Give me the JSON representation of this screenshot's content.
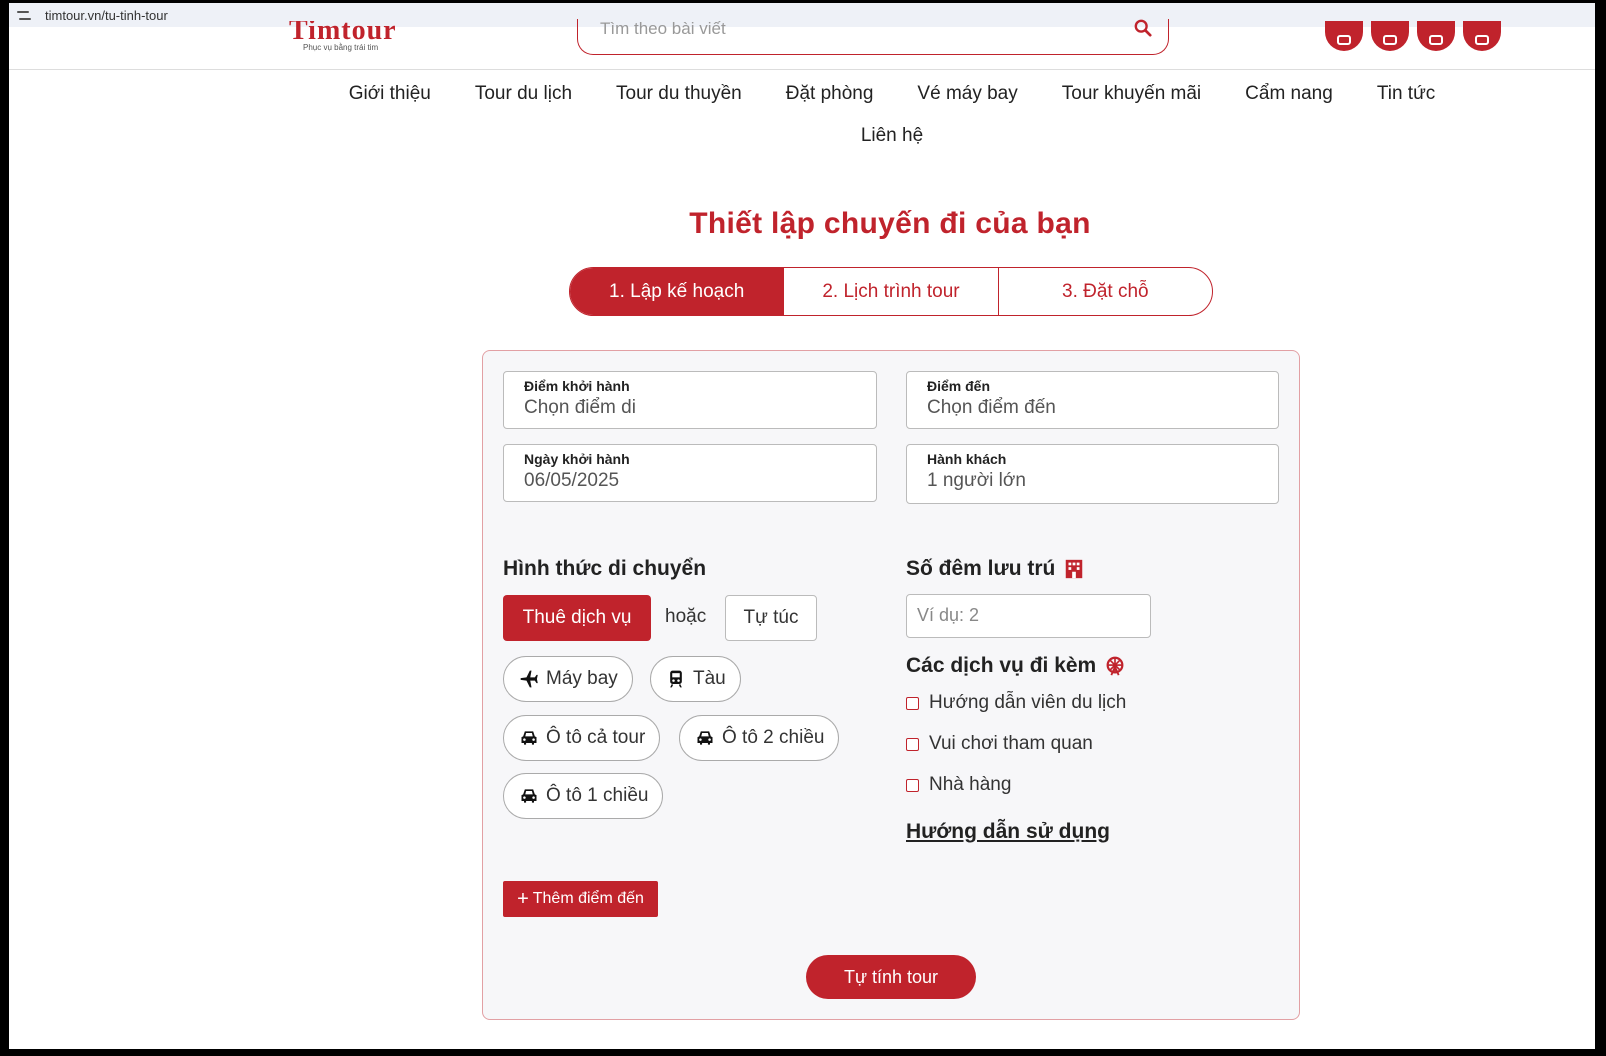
{
  "browser": {
    "url": "timtour.vn/tu-tinh-tour"
  },
  "header": {
    "logo_text": "Timtour",
    "logo_tagline": "Phục vụ bằng trái tim",
    "search_placeholder": "Tìm theo bài viết",
    "socials": [
      "facebook-icon",
      "youtube-icon",
      "instagram-icon",
      "tiktok-icon"
    ]
  },
  "nav": {
    "items": [
      "Giới thiệu",
      "Tour du lịch",
      "Tour du thuyền",
      "Đặt phòng",
      "Vé máy bay",
      "Tour khuyến mãi",
      "Cẩm nang",
      "Tin tức"
    ],
    "contact": "Liên hệ"
  },
  "page_title": "Thiết lập chuyến đi của bạn",
  "steps": [
    "1. Lập kế hoạch",
    "2. Lịch trình tour",
    "3. Đặt chỗ"
  ],
  "form": {
    "departure": {
      "label": "Điểm khởi hành",
      "value": "Chọn điểm di"
    },
    "destination": {
      "label": "Điểm đến",
      "value": "Chọn điểm đến"
    },
    "date": {
      "label": "Ngày khởi hành",
      "value": "06/05/2025"
    },
    "guests": {
      "label": "Hành khách",
      "value": "1 người lớn"
    }
  },
  "transport": {
    "title": "Hình thức di chuyển",
    "hire": "Thuê dịch vụ",
    "or": "hoặc",
    "self": "Tự túc",
    "options": [
      "Máy bay",
      "Tàu",
      "Ô tô cả tour",
      "Ô tô 2 chiều",
      "Ô tô 1 chiều"
    ]
  },
  "stay": {
    "title": "Số đêm lưu trú",
    "placeholder": "Ví dụ: 2"
  },
  "services": {
    "title": "Các dịch vụ đi kèm",
    "items": [
      "Hướng dẫn viên du lịch",
      "Vui chơi tham quan",
      "Nhà hàng"
    ]
  },
  "guide_link": "Hướng dẫn sử dụng",
  "add_destination": "Thêm điểm đến",
  "submit": "Tự tính tour",
  "colors": {
    "accent": "#c0232c"
  }
}
